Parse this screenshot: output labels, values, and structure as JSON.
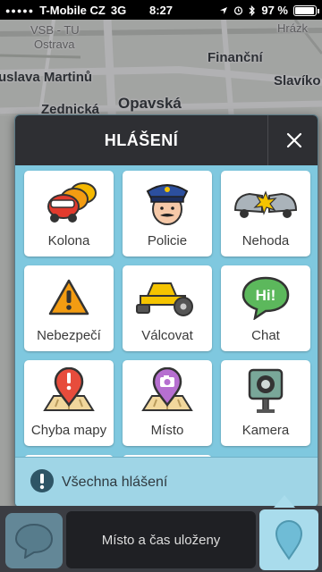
{
  "status_bar": {
    "carrier": "T-Mobile CZ",
    "network": "3G",
    "time": "8:27",
    "battery_percent": "97 %",
    "battery_level": 0.97
  },
  "map": {
    "labels": {
      "vsb": "VSB - TU",
      "ostrava": "Ostrava",
      "hrazka": "Hrázk",
      "financni": "Finanční",
      "martinu": "uslava Martinů",
      "slavikov": "Slavíko",
      "opavska": "Opavská",
      "zednicka": "Zednická"
    }
  },
  "dialog": {
    "title": "HLÁŠENÍ",
    "tiles": [
      {
        "label": "Kolona",
        "icon": "traffic-jam-icon"
      },
      {
        "label": "Policie",
        "icon": "police-icon"
      },
      {
        "label": "Nehoda",
        "icon": "accident-icon"
      },
      {
        "label": "Nebezpečí",
        "icon": "hazard-icon"
      },
      {
        "label": "Válcovat",
        "icon": "road-roller-icon"
      },
      {
        "label": "Chat",
        "icon": "chat-icon"
      },
      {
        "label": "Chyba mapy",
        "icon": "map-error-icon"
      },
      {
        "label": "Místo",
        "icon": "place-icon"
      },
      {
        "label": "Kamera",
        "icon": "camera-icon"
      }
    ],
    "all_reports_label": "Všechna hlášení"
  },
  "bottom_bar": {
    "status_message": "Místo a čas uloženy"
  },
  "colors": {
    "dialog_bg": "#7fc8df",
    "header_bg": "#2e2f33",
    "hazard_orange": "#f39c12",
    "alert_red": "#e74c3c",
    "chat_green": "#5cb85c",
    "place_purple": "#b66fd0"
  }
}
